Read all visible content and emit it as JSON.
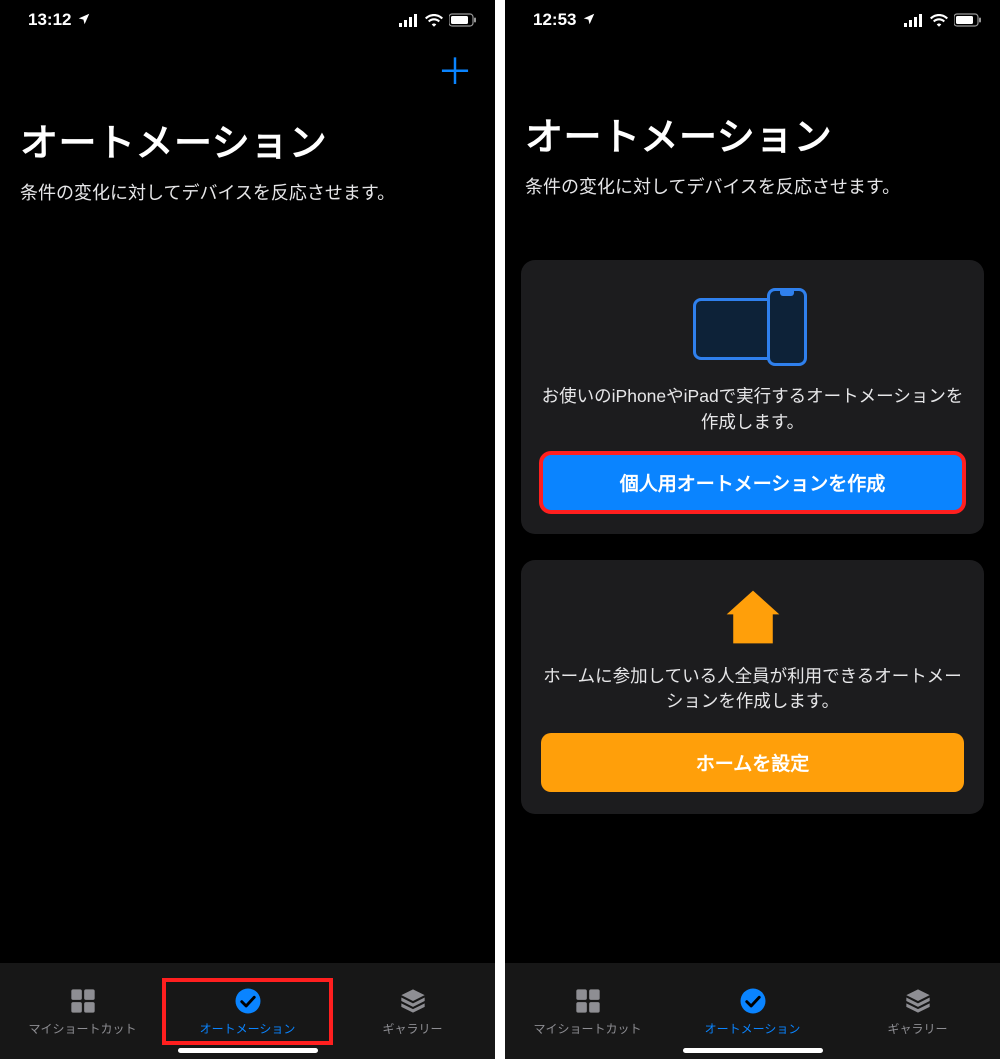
{
  "left": {
    "time": "13:12",
    "title": "オートメーション",
    "subtitle": "条件の変化に対してデバイスを反応させます。"
  },
  "right": {
    "time": "12:53",
    "title": "オートメーション",
    "subtitle": "条件の変化に対してデバイスを反応させます。",
    "card_personal": {
      "desc": "お使いのiPhoneやiPadで実行するオートメーションを作成します。",
      "button": "個人用オートメーションを作成"
    },
    "card_home": {
      "desc": "ホームに参加している人全員が利用できるオートメーションを作成します。",
      "button": "ホームを設定"
    }
  },
  "tabs": {
    "shortcuts": "マイショートカット",
    "automation": "オートメーション",
    "gallery": "ギャラリー"
  }
}
